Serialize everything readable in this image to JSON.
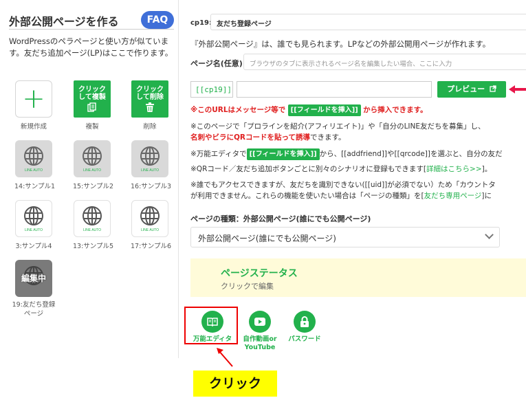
{
  "sidebar": {
    "title": "外部公開ページを作る",
    "faq_label": "FAQ",
    "description": "WordPressのペラページと使い方が似ています。友だち追加ページ(LP)はここで作ります。",
    "actions": [
      {
        "label": "新規作成",
        "icon": "plus-icon"
      },
      {
        "label": "複製",
        "button_text_1": "クリック",
        "button_text_2": "して複製",
        "icon": "copy-icon"
      },
      {
        "label": "削除",
        "button_text_1": "クリック",
        "button_text_2": "して削除",
        "icon": "trash-icon"
      }
    ],
    "pages": [
      {
        "label": "14:サンプル1",
        "style": "gray"
      },
      {
        "label": "15:サンプル2",
        "style": "gray"
      },
      {
        "label": "16:サンプル3",
        "style": "gray"
      },
      {
        "label": "3:サンプル4",
        "style": "white"
      },
      {
        "label": "13:サンプル5",
        "style": "white"
      },
      {
        "label": "17:サンプル6",
        "style": "white"
      },
      {
        "label": "19:友だち登録ページ",
        "style": "editing",
        "badge": "編集中"
      }
    ],
    "globe_caption": "LINE AUTO"
  },
  "main": {
    "cp_label": "cp19:",
    "cp_name": "友だち登録ページ",
    "intro": "『外部公開ページ』は、誰でも見られます。LPなどの外部公開用ページが作れます。",
    "page_name_label": "ページ名(任意)",
    "page_name_placeholder": "ブラウザのタブに表示されるページ名を編集したい場合、ここに入力",
    "url_tag": "[[cp19]]",
    "url_value": "",
    "preview_label": "プレビュー",
    "note1_pre": "※このURLはメッセージ等で",
    "note1_chip": "[[フィールドを挿入]]",
    "note1_post": "から挿入できます。",
    "note2_a": "※このページで「プロラインを紹介(アフィリエイト)」や「自分のLINE友だちを募集」し、",
    "note2_b_red": "名刺やビラにQRコードを貼って誘導",
    "note2_b_post": "できます。",
    "note3_pre": "※万能エディタで",
    "note3_chip": "[[フィールドを挿入]]",
    "note3_post": "から、[[addfriend]]や[[qrcode]]を選ぶと、自分の友だ",
    "note4_pre": "※QRコード／友だち追加ボタンごとに別々のシナリオに登録もできます[",
    "note4_link": "詳細はこちら>>",
    "note4_post": "]。",
    "note5_a": "※誰でもアクセスできますが、友だちを識別できない([[uid]]が必須でない）ため「カウントタ",
    "note5_b_pre": "が利用できません。これらの機能を使いたい場合は「ページの種類」を[",
    "note5_link": "友だち専用ページ",
    "note5_b_post": "]に",
    "kind_label": "ページの種類：外部公開ページ(誰にでも公開ページ)",
    "kind_value": "外部公開ページ(誰にでも公開ページ)",
    "status_title": "ページステータス",
    "status_sub": "クリックで編集",
    "tools": [
      {
        "label": "万能エディタ",
        "icon": "book-icon"
      },
      {
        "label": "自作動画or YouTube",
        "icon": "youtube-icon"
      },
      {
        "label": "パスワード",
        "icon": "lock-icon"
      }
    ]
  },
  "annotation": {
    "callout": "クリック"
  },
  "colors": {
    "accent_green": "#22b14c",
    "faq_blue": "#3f6fd8",
    "highlight_red": "#e00000",
    "callout_yellow": "#ffff00"
  }
}
